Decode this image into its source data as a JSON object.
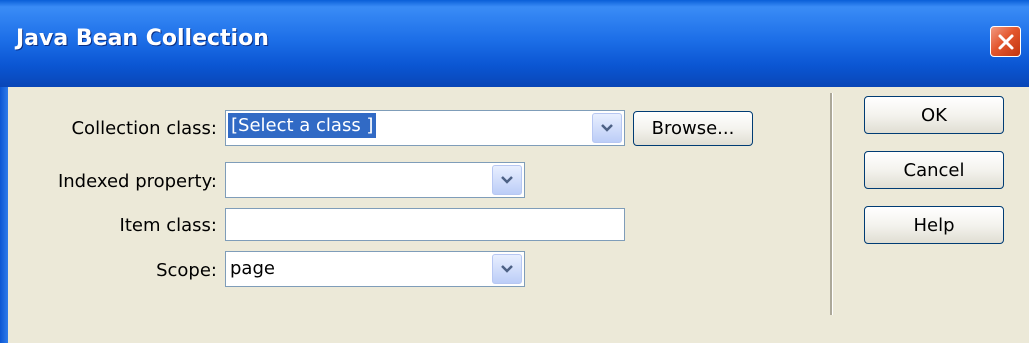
{
  "window": {
    "title": "Java Bean Collection"
  },
  "form": {
    "collection_class_label": "Collection class:",
    "collection_class_value": "[Select a class ]",
    "browse_label": "Browse...",
    "indexed_property_label": "Indexed property:",
    "indexed_property_value": "",
    "item_class_label": "Item class:",
    "item_class_value": "",
    "scope_label": "Scope:",
    "scope_value": "page"
  },
  "buttons": {
    "ok": "OK",
    "cancel": "Cancel",
    "help": "Help"
  },
  "icons": {
    "close": "close-icon",
    "dropdown": "chevron-down-icon"
  },
  "colors": {
    "titlebar": "#0b56d3",
    "dialog_bg": "#ece9d8",
    "selection": "#316ac5",
    "close_button": "#e4572e"
  }
}
